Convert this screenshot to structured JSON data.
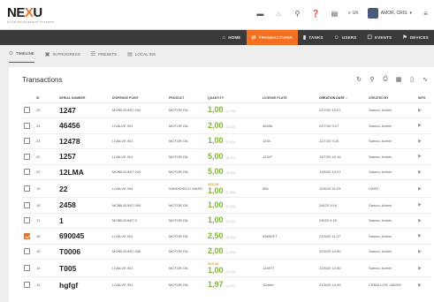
{
  "app": {
    "logo_text": "NEXU",
    "logo_subtitle": "FLUID MANAGEMENT SYSTEMS"
  },
  "top": {
    "icons": [
      "card-icon",
      "flame-icon",
      "pin-icon",
      "help-icon",
      "terminal-icon"
    ],
    "language": "UK",
    "user_name": "AMOR, CRIS"
  },
  "nav": {
    "items": [
      {
        "label": "HOME",
        "icon": "home-icon"
      },
      {
        "label": "TRANSACTIONS",
        "icon": "transactions-icon"
      },
      {
        "label": "TANKS",
        "icon": "tanks-icon"
      },
      {
        "label": "USERS",
        "icon": "users-icon"
      },
      {
        "label": "EVENTS",
        "icon": "events-icon"
      },
      {
        "label": "DEVICES",
        "icon": "devices-icon"
      }
    ],
    "active_index": 1
  },
  "subtabs": {
    "items": [
      {
        "label": "TIMELINE"
      },
      {
        "label": "IN PROGRESS"
      },
      {
        "label": "PRESETS"
      },
      {
        "label": "LOCAL INS"
      }
    ],
    "active_index": 0
  },
  "card": {
    "title": "Transactions",
    "tools": [
      "refresh-icon",
      "search-icon",
      "print-icon",
      "calendar-icon",
      "file-icon",
      "chart-icon"
    ]
  },
  "table": {
    "columns": [
      "ID",
      "SERIAL NUMBER",
      "DISPENSE POINT",
      "PRODUCT",
      "QUANTITY",
      "LICENSE PLATE",
      "CREATION DATE",
      "CREATED BY",
      "INFO"
    ],
    "rows": [
      {
        "id": "25",
        "serial": "1247",
        "point": "MOBILEUNIT 004",
        "product": "MOTOR OIL",
        "qty": "1,00",
        "qmax": "(1,00)",
        "over": "",
        "plate": "",
        "date": "22/7/20 15:07",
        "by": "Samou, Admin",
        "checked": false
      },
      {
        "id": "24",
        "serial": "46456",
        "point": "LIVALVE 001",
        "product": "MOTOR OIL",
        "qty": "2,00",
        "qmax": "(2,00)",
        "over": "",
        "plate": "46456",
        "date": "22/7/20 9:27",
        "by": "Samou, Admin",
        "checked": false
      },
      {
        "id": "23",
        "serial": "12478",
        "point": "LIVALVE 001",
        "product": "MOTOR OIL",
        "qty": "1,00",
        "qmax": "(1,00)",
        "over": "",
        "plate": "1234",
        "date": "22/7/20 9:25",
        "by": "Samou, Admin",
        "checked": false
      },
      {
        "id": "22",
        "serial": "1257",
        "point": "LIVALVE 001",
        "product": "MOTOR OIL",
        "qty": "5,00",
        "qmax": "(5,00)",
        "over": "",
        "plate": "12347",
        "date": "13/7/20 15:16",
        "by": "Samou, Admin",
        "checked": false
      },
      {
        "id": "20",
        "serial": "12LMA",
        "point": "MOBILEUNIT 004",
        "product": "MOTOR OIL",
        "qty": "5,00",
        "qmax": "(5,00)",
        "over": "",
        "plate": "",
        "date": "13/6/20 19:07",
        "by": "Samou, Admin",
        "checked": false
      },
      {
        "id": "19",
        "serial": "22",
        "point": "LIVALVE 004",
        "product": "WINDSHIELD WASH",
        "qty": "1,00",
        "qmax": "(1,00)",
        "over": "323.25",
        "plate": "555",
        "date": "11/6/20 15:23",
        "by": "USER",
        "checked": false
      },
      {
        "id": "18",
        "serial": "2458",
        "point": "MOBILEUNIT 004",
        "product": "MOTOR OIL",
        "qty": "1,00",
        "qmax": "(1,00)",
        "over": "",
        "plate": "",
        "date": "2/6/20 9:16",
        "by": "Samou, Admin",
        "checked": false
      },
      {
        "id": "17",
        "serial": "1",
        "point": "MOBILEUNIT 5",
        "product": "MOTOR OIL",
        "qty": "1,00",
        "qmax": "(1,00)",
        "over": "",
        "plate": "",
        "date": "2/6/20 9:15",
        "by": "Samou, Admin",
        "checked": false
      },
      {
        "id": "16",
        "serial": "690045",
        "point": "LIVALVE 001",
        "product": "MOTOR OIL",
        "qty": "2,50",
        "qmax": "(2,50)",
        "over": "",
        "plate": "5365DFT",
        "date": "22/5/20 11:37",
        "by": "Samou, Admin",
        "checked": true
      },
      {
        "id": "15",
        "serial": "T0006",
        "point": "MOBILEUNIT 006",
        "product": "MOTOR OIL",
        "qty": "2,00",
        "qmax": "(2,00)",
        "over": "",
        "plate": "",
        "date": "22/5/20 10:50",
        "by": "Samou, Admin",
        "checked": false
      },
      {
        "id": "14",
        "serial": "T005",
        "point": "LIVALVE 001",
        "product": "MOTOR OIL",
        "qty": "1,00",
        "qmax": "(1,00)",
        "over": "323.43",
        "plate": "1249TT",
        "date": "22/5/20 10:50",
        "by": "Samou, Admin",
        "checked": false
      },
      {
        "id": "13",
        "serial": "hgfgf",
        "point": "LIVALVE 001",
        "product": "MOTOR OIL",
        "qty": "1,97",
        "qmax": "(1,97)",
        "over": "",
        "plate": "12rrtee",
        "date": "21/5/20 14:09",
        "by": "CEBALLOS, JAVIER",
        "checked": false
      }
    ]
  },
  "colors": {
    "accent": "#f37021",
    "quantity": "#7db92e",
    "navbar": "#3a3a3a"
  }
}
